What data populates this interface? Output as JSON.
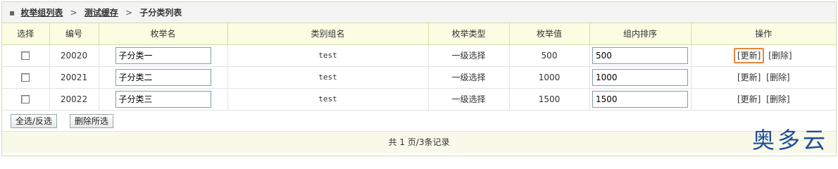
{
  "breadcrumb": {
    "items": [
      "枚举组列表",
      "测试缓存"
    ],
    "current": "子分类列表",
    "separator": ">"
  },
  "table": {
    "headers": {
      "select": "选择",
      "id": "编号",
      "name": "枚举名",
      "group": "类别组名",
      "type": "枚举类型",
      "value": "枚举值",
      "sort": "组内排序",
      "ops": "操作"
    },
    "rows": [
      {
        "id": "20020",
        "name": "子分类一",
        "group": "test",
        "type": "一级选择",
        "value": "500",
        "sort": "500",
        "update": "[更新]",
        "delete": "[删除]"
      },
      {
        "id": "20021",
        "name": "子分类二",
        "group": "test",
        "type": "一级选择",
        "value": "1000",
        "sort": "1000",
        "update": "[更新]",
        "delete": "[删除]"
      },
      {
        "id": "20022",
        "name": "子分类三",
        "group": "test",
        "type": "一级选择",
        "value": "1500",
        "sort": "1500",
        "update": "[更新]",
        "delete": "[删除]"
      }
    ]
  },
  "buttons": {
    "select_all": "全选/反选",
    "delete_selected": "删除所选"
  },
  "pager": {
    "text": "共 1 页/3条记录"
  },
  "watermark": "奥多云",
  "colors": {
    "header_bg": "#fbfce2",
    "border": "#d1ddaa",
    "highlight": "#e8873f",
    "watermark": "#1e4e9b"
  }
}
